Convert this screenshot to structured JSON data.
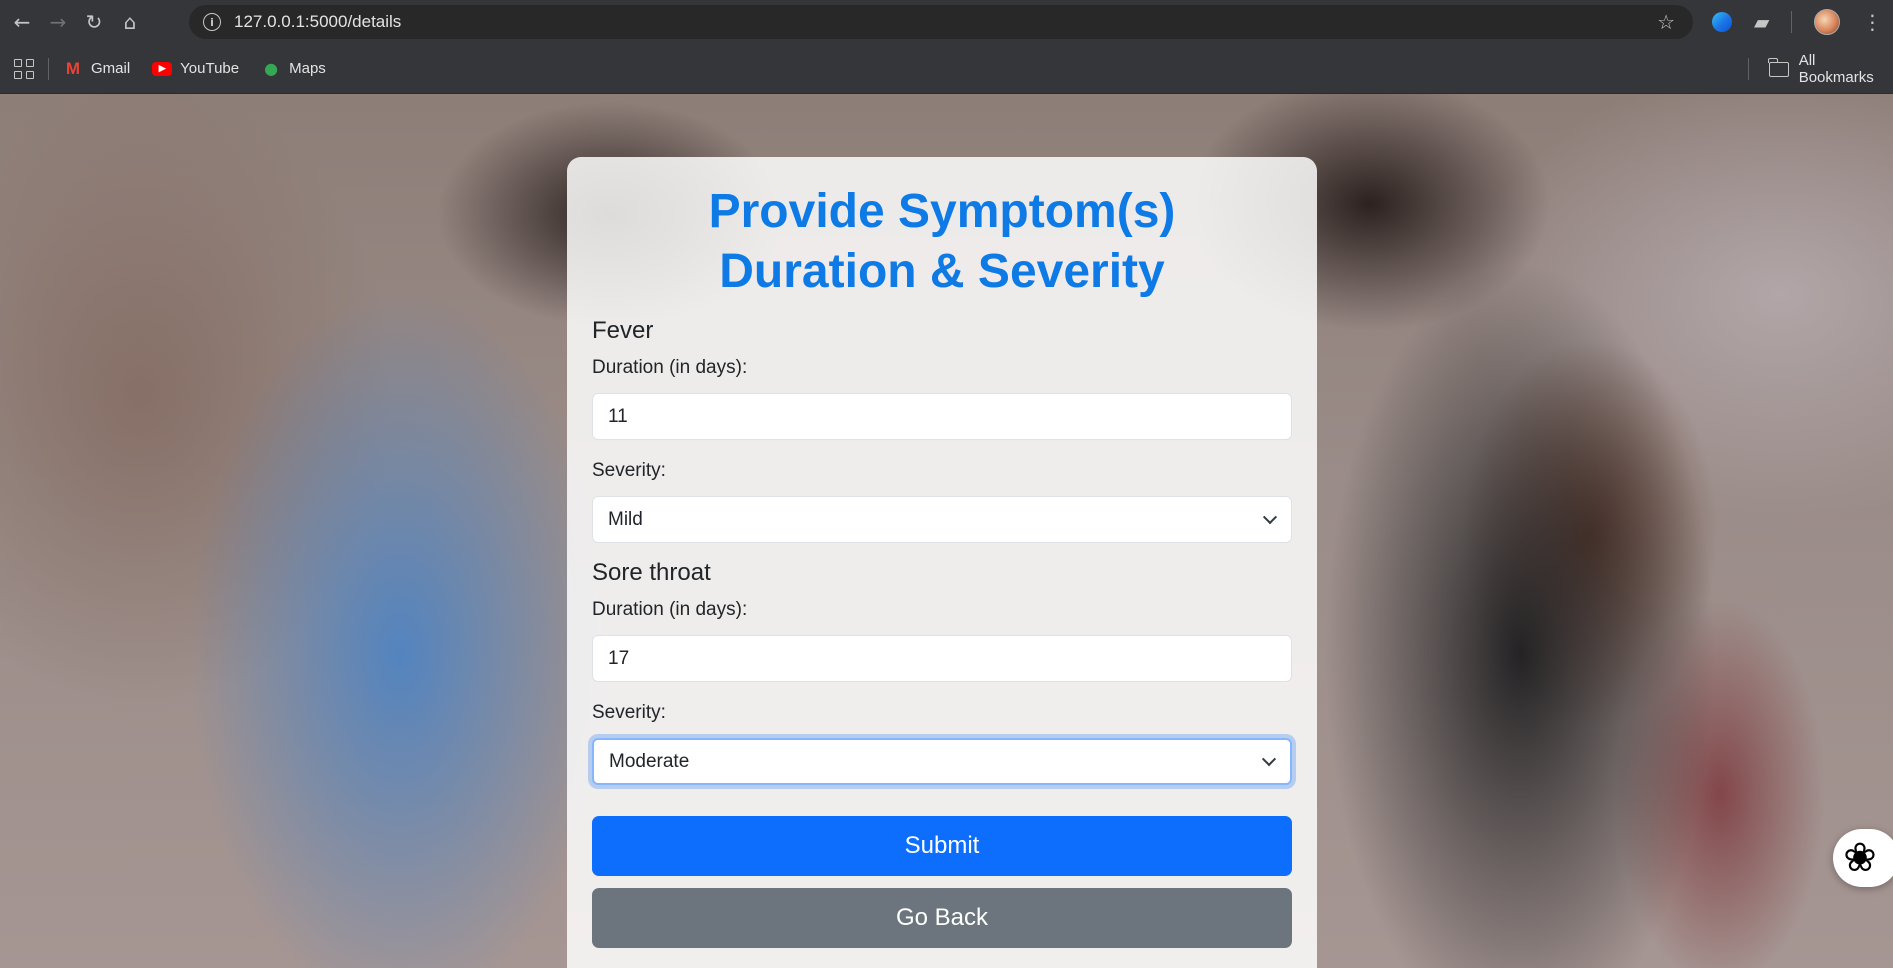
{
  "browser": {
    "url": "127.0.0.1:5000/details",
    "bookmarks": [
      {
        "label": "Gmail",
        "icon": "gmail-icon"
      },
      {
        "label": "YouTube",
        "icon": "youtube-icon"
      },
      {
        "label": "Maps",
        "icon": "maps-icon"
      }
    ],
    "all_bookmarks_label": "All Bookmarks"
  },
  "form": {
    "title_line1": "Provide Symptom(s)",
    "title_line2": "Duration & Severity",
    "title_color": "#0d7ae6",
    "symptoms": [
      {
        "name": "Fever",
        "duration_label": "Duration (in days):",
        "duration_value": "11",
        "severity_label": "Severity:",
        "severity_value": "Mild"
      },
      {
        "name": "Sore throat",
        "duration_label": "Duration (in days):",
        "duration_value": "17",
        "severity_label": "Severity:",
        "severity_value": "Moderate"
      }
    ],
    "submit_label": "Submit",
    "back_label": "Go Back",
    "submit_color": "#0d6efd",
    "back_color": "#6c757d"
  }
}
